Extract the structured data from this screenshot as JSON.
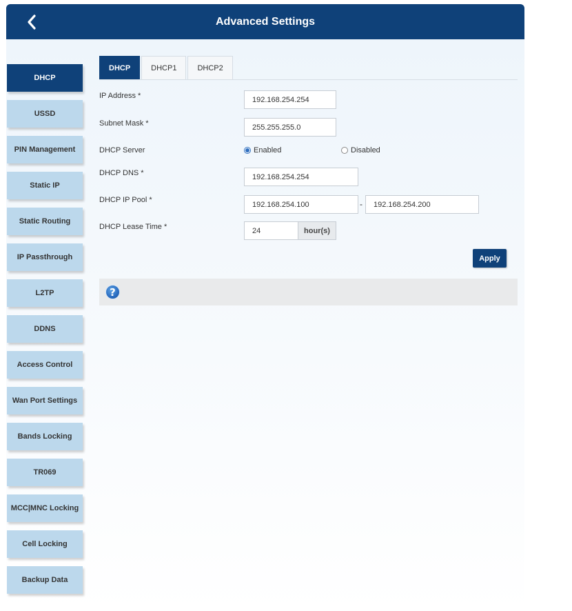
{
  "header": {
    "title": "Advanced Settings"
  },
  "sidebar": {
    "items": [
      {
        "label": "DHCP"
      },
      {
        "label": "USSD"
      },
      {
        "label": "PIN Management"
      },
      {
        "label": "Static IP"
      },
      {
        "label": "Static Routing"
      },
      {
        "label": "IP Passthrough"
      },
      {
        "label": "L2TP"
      },
      {
        "label": "DDNS"
      },
      {
        "label": "Access Control"
      },
      {
        "label": "Wan Port Settings"
      },
      {
        "label": "Bands Locking"
      },
      {
        "label": "TR069"
      },
      {
        "label": "MCC|MNC Locking"
      },
      {
        "label": "Cell Locking"
      },
      {
        "label": "Backup Data"
      }
    ],
    "active_index": 0
  },
  "tabs": [
    {
      "label": "DHCP"
    },
    {
      "label": "DHCP1"
    },
    {
      "label": "DHCP2"
    }
  ],
  "form": {
    "ip_address": {
      "label": "IP Address *",
      "value": "192.168.254.254"
    },
    "subnet_mask": {
      "label": "Subnet Mask *",
      "value": "255.255.255.0"
    },
    "dhcp_server": {
      "label": "DHCP Server",
      "enabled_label": "Enabled",
      "disabled_label": "Disabled",
      "selected": "Enabled"
    },
    "dhcp_dns": {
      "label": "DHCP DNS *",
      "value": "192.168.254.254"
    },
    "dhcp_ip_pool": {
      "label": "DHCP IP Pool *",
      "start": "192.168.254.100",
      "separator": "-",
      "end": "192.168.254.200"
    },
    "lease_time": {
      "label": "DHCP Lease Time *",
      "value": "24",
      "unit": "hour(s)"
    }
  },
  "apply_label": "Apply",
  "help": {
    "icon": "question-icon",
    "glyph": "?"
  },
  "colors": {
    "primary": "#0f4179",
    "sidebar_item": "#bcd8ec",
    "radio": "#2f6fbf"
  }
}
